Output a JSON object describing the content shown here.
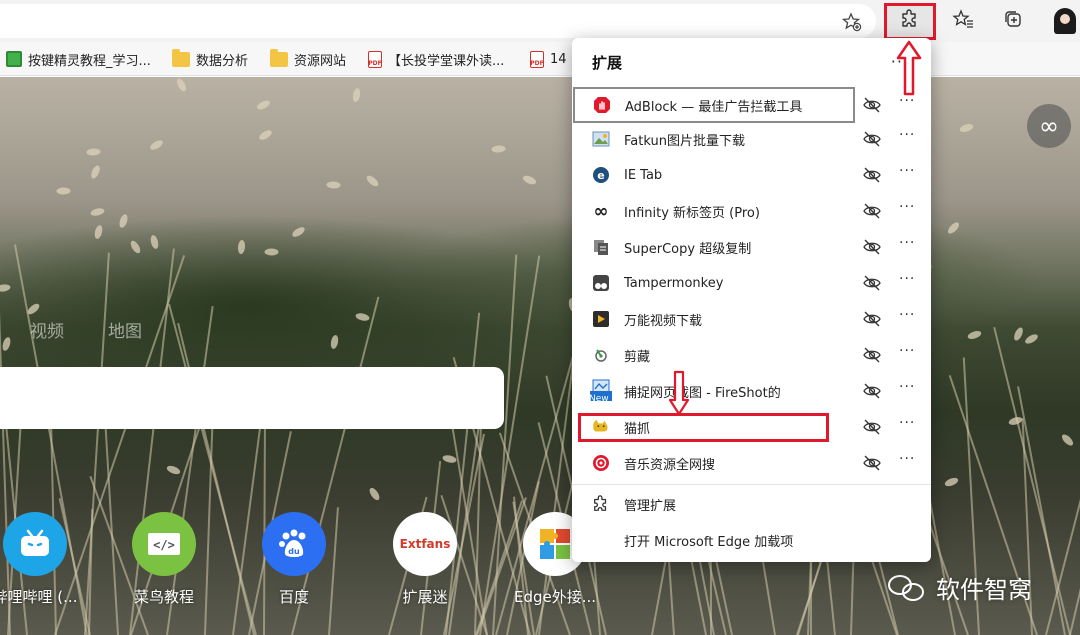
{
  "toolbar": {
    "favorites_icon": "star-plus-icon",
    "extensions_icon": "puzzle-icon",
    "favorites_list_icon": "star-list-icon",
    "collections_icon": "collections-icon",
    "profile_icon": "avatar-icon"
  },
  "bookmarks": [
    {
      "label": "按键精灵教程_学习...",
      "icon": "green-app-icon"
    },
    {
      "label": "数据分析",
      "icon": "folder-icon"
    },
    {
      "label": "资源网站",
      "icon": "folder-icon"
    },
    {
      "label": "【长投学堂课外读...",
      "icon": "pdf-icon"
    },
    {
      "label": "14",
      "icon": "pdf-icon"
    }
  ],
  "newtab": {
    "tabs": [
      "视频",
      "地图"
    ],
    "infinity_icon": "∞",
    "shortcuts": [
      {
        "label": "哔哩哔哩 (...",
        "icon": "bilibili-icon",
        "color": "#1ea5e8"
      },
      {
        "label": "菜鸟教程",
        "icon": "code-icon",
        "color": "#7bc142"
      },
      {
        "label": "百度",
        "icon": "baidu-paw-icon",
        "color": "#2d6ff2"
      },
      {
        "label": "扩展迷",
        "icon": "extfans-icon",
        "logo_text": "Extfans",
        "color": "#ffffff"
      },
      {
        "label": "Edge外接...",
        "icon": "puzzle-colorful-icon",
        "color": "#ffffff"
      }
    ]
  },
  "popup": {
    "title": "扩展",
    "more": "···",
    "extensions": [
      {
        "name": "AdBlock — 最佳广告拦截工具",
        "icon": "adblock-icon",
        "color": "#e0192d"
      },
      {
        "name": "Fatkun图片批量下载",
        "icon": "image-icon",
        "color": "#7ea6d8"
      },
      {
        "name": "IE Tab",
        "icon": "ie-tab-icon",
        "color": "#1f4f7a"
      },
      {
        "name": "Infinity 新标签页 (Pro)",
        "icon": "infinity-icon",
        "color": "#222222"
      },
      {
        "name": "SuperCopy 超级复制",
        "icon": "copy-icon",
        "color": "#555555"
      },
      {
        "name": "Tampermonkey",
        "icon": "tampermonkey-icon",
        "color": "#444444"
      },
      {
        "name": "万能视频下载",
        "icon": "video-download-icon",
        "color": "#2d2d2d"
      },
      {
        "name": "剪藏",
        "icon": "clip-icon",
        "color": "#3a9a4a"
      },
      {
        "name": "捕捉网页截图 - FireShot的",
        "icon": "fireshot-icon",
        "color": "#1f6fd0",
        "badge": "New"
      },
      {
        "name": "猫抓",
        "icon": "cat-catch-icon",
        "color": "#e9b61f"
      },
      {
        "name": "音乐资源全网搜",
        "icon": "music-search-icon",
        "color": "#e0192d"
      }
    ],
    "footer": [
      {
        "label": "管理扩展",
        "icon": "puzzle-icon"
      },
      {
        "label": "打开 Microsoft Edge 加载项",
        "icon": ""
      }
    ]
  },
  "watermark": {
    "text": "软件智窝",
    "icon": "wechat-icon"
  }
}
